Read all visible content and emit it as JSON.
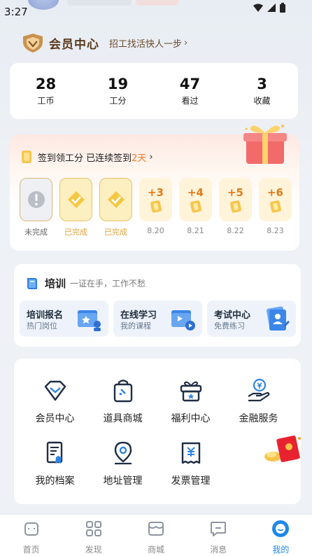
{
  "status_bar": {
    "time": "3:27"
  },
  "member": {
    "title": "会员中心",
    "link": "招工找活快人一步"
  },
  "stats": [
    {
      "value": "28",
      "label": "工币"
    },
    {
      "value": "19",
      "label": "工分"
    },
    {
      "value": "47",
      "label": "看过"
    },
    {
      "value": "3",
      "label": "收藏"
    }
  ],
  "signin": {
    "prefix": "签到领工分 已连续签到",
    "days": "2天",
    "days_list": [
      {
        "state": "incomplete",
        "label": "未完成"
      },
      {
        "state": "done",
        "label": "已完成"
      },
      {
        "state": "done",
        "label": "已完成"
      },
      {
        "state": "future",
        "bonus": "+3",
        "label": "8.20"
      },
      {
        "state": "future",
        "bonus": "+4",
        "label": "8.21"
      },
      {
        "state": "future",
        "bonus": "+5",
        "label": "8.22"
      },
      {
        "state": "future",
        "bonus": "+6",
        "label": "8.23"
      }
    ]
  },
  "training": {
    "title": "培训",
    "subtitle": "一证在手，工作不愁",
    "items": [
      {
        "title": "培训报名",
        "subtitle": "热门岗位"
      },
      {
        "title": "在线学习",
        "subtitle": "我的课程"
      },
      {
        "title": "考试中心",
        "subtitle": "免费练习"
      }
    ]
  },
  "services": [
    {
      "label": "会员中心",
      "icon": "diamond-icon"
    },
    {
      "label": "道具商城",
      "icon": "shopping-bag-icon"
    },
    {
      "label": "福利中心",
      "icon": "gift-box-icon"
    },
    {
      "label": "金融服务",
      "icon": "finance-hand-icon"
    },
    {
      "label": "我的档案",
      "icon": "profile-doc-icon"
    },
    {
      "label": "地址管理",
      "icon": "location-pin-icon"
    },
    {
      "label": "发票管理",
      "icon": "invoice-icon"
    }
  ],
  "nav": [
    {
      "label": "首页",
      "icon": "home-icon"
    },
    {
      "label": "发现",
      "icon": "discover-grid-icon"
    },
    {
      "label": "商城",
      "icon": "store-icon"
    },
    {
      "label": "消息",
      "icon": "message-icon"
    },
    {
      "label": "我的",
      "icon": "mine-face-icon",
      "active": true
    }
  ],
  "colors": {
    "accent_blue": "#1e88e5",
    "gold": "#e6c36a",
    "orange": "#f07a23",
    "brown": "#5a3a1c"
  }
}
